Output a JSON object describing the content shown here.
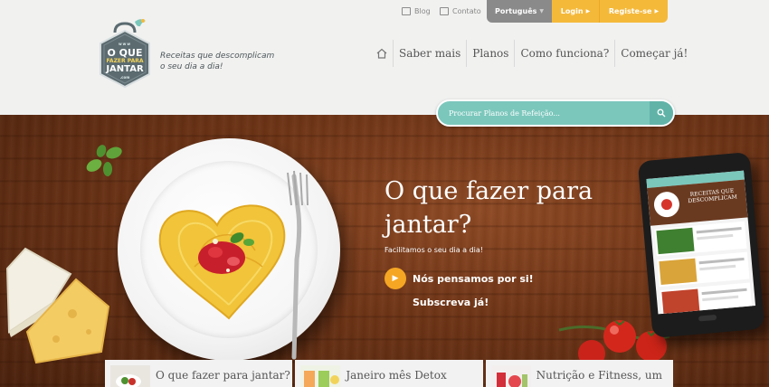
{
  "logo": {
    "www": "www",
    "line1": "O QUE",
    "line2": "FAZER PARA",
    "line3": "JANTAR",
    "com": ".com",
    "tagline": "Receitas que descomplicam o seu dia a dia!"
  },
  "topbar": {
    "blog": "Blog",
    "contato": "Contato",
    "language": "Português",
    "login": "Login",
    "register": "Registe-se"
  },
  "nav": {
    "items": [
      "Saber mais",
      "Planos",
      "Como funciona?",
      "Começar já!"
    ]
  },
  "search": {
    "placeholder": "Procurar Planos de Refeição..."
  },
  "hero": {
    "title": "O que fazer para jantar?",
    "subtitle": "Facilitamos o seu dia a dia!",
    "cta": "Nós pensamos por si!",
    "subscribe": "Subscreva já!"
  },
  "phone_screen": {
    "header": "RECEITAS QUE DESCOMPLICAM"
  },
  "cards": [
    {
      "title": "O que fazer para jantar?"
    },
    {
      "title": "Janeiro mês Detox"
    },
    {
      "title": "Nutrição e Fitness, um"
    }
  ],
  "colors": {
    "accent_teal": "#7bc7bc",
    "accent_orange": "#f5b93a",
    "gray_button": "#8a8a8a",
    "wood": "#6e3416"
  },
  "icons": {
    "home": "home-icon",
    "blog": "blog-icon",
    "contato": "mail-icon",
    "search": "search-icon",
    "cta": "chevron-right-icon"
  }
}
